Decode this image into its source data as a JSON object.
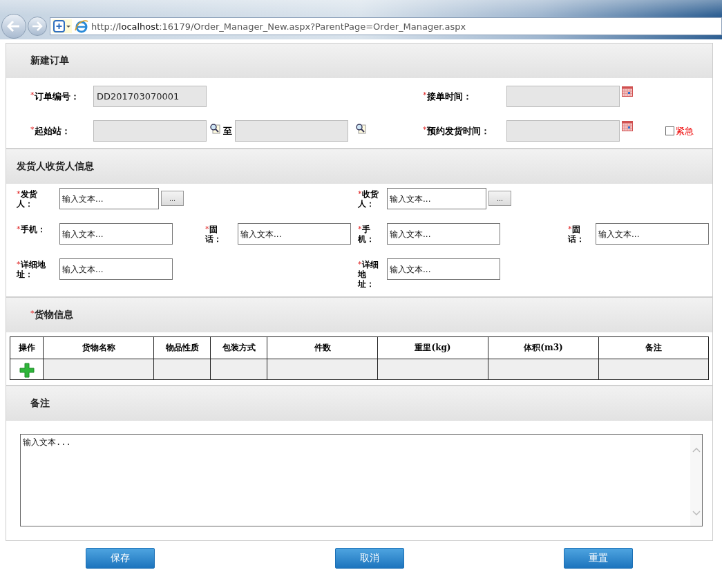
{
  "browser": {
    "url": "http://**localhost**:16179/Order_Manager_New.aspx?ParentPage=Order_Manager.aspx"
  },
  "order": {
    "title": "新建订单",
    "order_no": {
      "label": "订单编号：",
      "mark": "*",
      "value": "DD201703070001"
    },
    "receive_time": {
      "label": "接单时间：",
      "mark": "*"
    },
    "station": {
      "label": "起始站：",
      "mark": "*",
      "separator": "至"
    },
    "ship_time": {
      "label": "预约发货时间：",
      "mark": "*"
    },
    "urgent": {
      "label": "紧急",
      "checked": false
    }
  },
  "parties": {
    "title": "发货人收货人信息",
    "rows": [
      [
        {
          "kind": "picker",
          "label": "发货人：",
          "mark": "*",
          "placeholder": "输入文本...",
          "button": "..."
        },
        {
          "kind": "picker",
          "label": "收货人：",
          "mark": "*",
          "placeholder": "输入文本...",
          "button": "..."
        }
      ],
      [
        {
          "kind": "text",
          "label": "手机：",
          "mark": "*",
          "placeholder": "输入文本..."
        },
        {
          "kind": "text",
          "label": "固话：",
          "mark": "*",
          "placeholder": "输入文本..."
        },
        {
          "kind": "text",
          "label": "手机：",
          "mark": "*",
          "placeholder": "输入文本..."
        },
        {
          "kind": "text",
          "label": "固话：",
          "mark": "*",
          "placeholder": "输入文本..."
        }
      ],
      [
        {
          "kind": "text",
          "label": "详细地址：",
          "mark": "*",
          "placeholder": "输入文本..."
        },
        {
          "kind": "text",
          "label": "详细地址：",
          "mark": "*",
          "placeholder": "输入文本..."
        }
      ]
    ]
  },
  "goods": {
    "title": "货物信息",
    "mark": "*",
    "columns": [
      "操作",
      "货物名称",
      "物品性质",
      "包装方式",
      "件数",
      "重里(kg)",
      "体积(m3)",
      "备注"
    ]
  },
  "remarks": {
    "title": "备注",
    "placeholder": "输入文本..."
  },
  "buttons": [
    "保存",
    "取消",
    "重置"
  ]
}
